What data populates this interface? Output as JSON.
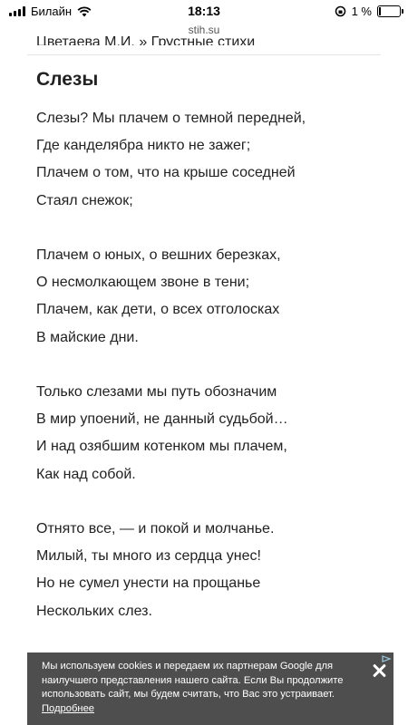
{
  "status_bar": {
    "carrier": "Билайн",
    "time": "18:13",
    "battery": "1 %",
    "battery_level": 0.01
  },
  "browser": {
    "url": "stih.su"
  },
  "breadcrumb": {
    "author": "Цветаева М.И.",
    "separator": "»",
    "section": "Грустные стихи"
  },
  "poem": {
    "title": "Слезы",
    "stanzas": [
      [
        "Слезы? Мы плачем о темной передней,",
        "Где канделябра никто не зажег;",
        "Плачем о том, что на крыше соседней",
        "Стаял снежок;"
      ],
      [
        "Плачем о юных, о вешних березках,",
        "О несмолкающем звоне в тени;",
        "Плачем, как дети, о всех отголосках",
        "В майские дни."
      ],
      [
        "Только слезами мы путь обозначим",
        "В мир упоений, не данный судьбой…",
        "И над озябшим котенком мы плачем,",
        "Как над собой."
      ],
      [
        "Отнято все, — и покой и молчанье.",
        "Милый, ты много из сердца унес!",
        "Но не сумел унести на прощанье",
        "Нескольких слез."
      ]
    ]
  },
  "cookie_banner": {
    "text": "Мы используем cookies и передаем их партнерам Google для наилучшего представления нашего сайта. Если Вы продолжите использовать сайт, мы будем считать, что Вас это устраивает.",
    "link": "Подробнее"
  }
}
